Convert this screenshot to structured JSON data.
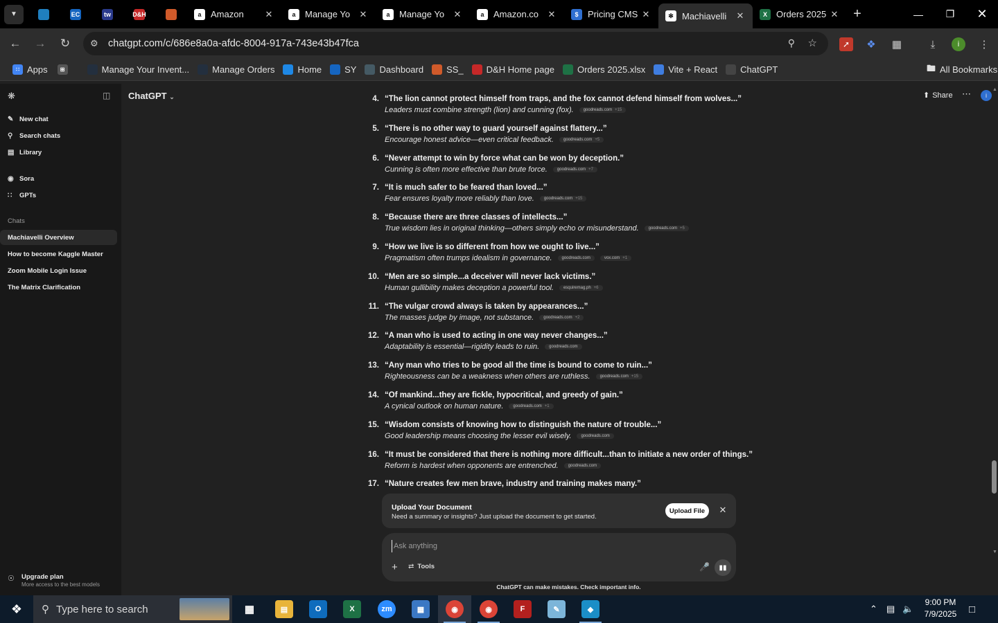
{
  "browser": {
    "tabs": [
      {
        "title": "Amazon",
        "favicon": "amazon-icon"
      },
      {
        "title": "Manage Yo",
        "favicon": "amazon-icon"
      },
      {
        "title": "Manage Yo",
        "favicon": "amazon-icon"
      },
      {
        "title": "Amazon.co",
        "favicon": "amazon-icon"
      },
      {
        "title": "Pricing CMS",
        "favicon": "dollar-icon"
      },
      {
        "title": "Machiavelli",
        "favicon": "openai-icon"
      },
      {
        "title": "Orders 2025",
        "favicon": "excel-icon"
      }
    ],
    "pinned_tabs": [
      {
        "label": "",
        "color": "#1f7fbf"
      },
      {
        "label": "EC",
        "color": "#1565c0"
      },
      {
        "label": "tw",
        "color": "#2a3a8c"
      },
      {
        "label": "D&H",
        "color": "#c62828"
      },
      {
        "label": "",
        "color": "#d05a2a"
      }
    ],
    "url": "chatgpt.com/c/686e8a0a-afdc-8004-917a-743e43b47fca",
    "bookmarks": [
      {
        "label": "Apps",
        "color": "#4285f4"
      },
      {
        "label": "",
        "color": "#555555"
      },
      {
        "label": "Manage Your Invent...",
        "color": "#232f3e"
      },
      {
        "label": "Manage Orders",
        "color": "#232f3e"
      },
      {
        "label": "Home",
        "color": "#1e88e5"
      },
      {
        "label": "SY",
        "color": "#1565c0"
      },
      {
        "label": "Dashboard",
        "color": "#455a64"
      },
      {
        "label": "SS_",
        "color": "#d05a2a"
      },
      {
        "label": "D&H Home page",
        "color": "#c62828"
      },
      {
        "label": "Orders 2025.xlsx",
        "color": "#1e7145"
      },
      {
        "label": "Vite + React",
        "color": "#3f7de0"
      },
      {
        "label": "ChatGPT",
        "color": "#444444"
      }
    ],
    "all_bookmarks": "All Bookmarks",
    "profile_initial": "i"
  },
  "sidebar": {
    "nav": [
      {
        "label": "New chat",
        "icon": "edit-icon"
      },
      {
        "label": "Search chats",
        "icon": "search-icon"
      },
      {
        "label": "Library",
        "icon": "library-icon"
      },
      {
        "label": "Sora",
        "icon": "sora-icon"
      },
      {
        "label": "GPTs",
        "icon": "gpts-icon"
      }
    ],
    "chats_heading": "Chats",
    "chats": [
      "Machiavelli Overview",
      "How to become Kaggle Master",
      "Zoom Mobile Login Issue",
      "The Matrix Clarification"
    ],
    "upgrade_title": "Upgrade plan",
    "upgrade_sub": "More access to the best models"
  },
  "header": {
    "model": "ChatGPT",
    "share": "Share",
    "profile_initial": "i"
  },
  "quotes": [
    {
      "num": "4.",
      "text": "“The lion cannot protect himself from traps, and the fox cannot defend himself from wolves...”",
      "note": "Leaders must combine strength (lion) and cunning (fox).",
      "sources": [
        "goodreads.com"
      ],
      "extra": "+15"
    },
    {
      "num": "5.",
      "text": "“There is no other way to guard yourself against flattery...”",
      "note": "Encourage honest advice—even critical feedback.",
      "sources": [
        "goodreads.com"
      ],
      "extra": "+5"
    },
    {
      "num": "6.",
      "text": "“Never attempt to win by force what can be won by deception.”",
      "note": "Cunning is often more effective than brute force.",
      "sources": [
        "goodreads.com"
      ],
      "extra": "+7"
    },
    {
      "num": "7.",
      "text": "“It is much safer to be feared than loved...”",
      "note": "Fear ensures loyalty more reliably than love.",
      "sources": [
        "goodreads.com"
      ],
      "extra": "+15"
    },
    {
      "num": "8.",
      "text": "“Because there are three classes of intellects...”",
      "note": "True wisdom lies in original thinking—others simply echo or misunderstand.",
      "sources": [
        "goodreads.com"
      ],
      "extra": "+5"
    },
    {
      "num": "9.",
      "text": "“How we live is so different from how we ought to live...”",
      "note": "Pragmatism often trumps idealism in governance.",
      "sources": [
        "goodreads.com",
        "vox.com"
      ],
      "extra": "+1"
    },
    {
      "num": "10.",
      "text": "“Men are so simple...a deceiver will never lack victims.”",
      "note": "Human gullibility makes deception a powerful tool.",
      "sources": [
        "esquiremag.ph"
      ],
      "extra": "+6"
    },
    {
      "num": "11.",
      "text": "“The vulgar crowd always is taken by appearances...”",
      "note": "The masses judge by image, not substance.",
      "sources": [
        "goodreads.com"
      ],
      "extra": "+2"
    },
    {
      "num": "12.",
      "text": "“A man who is used to acting in one way never changes...”",
      "note": "Adaptability is essential—rigidity leads to ruin.",
      "sources": [
        "goodreads.com"
      ],
      "extra": ""
    },
    {
      "num": "13.",
      "text": "“Any man who tries to be good all the time is bound to come to ruin...”",
      "note": "Righteousness can be a weakness when others are ruthless.",
      "sources": [
        "goodreads.com"
      ],
      "extra": "+15"
    },
    {
      "num": "14.",
      "text": "“Of mankind...they are fickle, hypocritical, and greedy of gain.”",
      "note": "A cynical outlook on human nature.",
      "sources": [
        "goodreads.com"
      ],
      "extra": "+1"
    },
    {
      "num": "15.",
      "text": "“Wisdom consists of knowing how to distinguish the nature of trouble...”",
      "note": "Good leadership means choosing the lesser evil wisely.",
      "sources": [
        "goodreads.com"
      ],
      "extra": ""
    },
    {
      "num": "16.",
      "text": "“It must be considered that there is nothing more difficult...than to initiate a new order of things.”",
      "note": "Reform is hardest when opponents are entrenched.",
      "sources": [
        "goodreads.com"
      ],
      "extra": ""
    },
    {
      "num": "17.",
      "text": "“Nature creates few men brave, industry and training makes many.”",
      "note": "",
      "sources": [],
      "extra": ""
    }
  ],
  "upload_card": {
    "title": "Upload Your Document",
    "subtitle": "Need a summary or insights? Just upload the document to get started.",
    "button": "Upload File"
  },
  "composer": {
    "placeholder": "Ask anything",
    "tools": "Tools"
  },
  "disclaimer": "ChatGPT can make mistakes. Check important info.",
  "taskbar": {
    "search_placeholder": "Type here to search",
    "time": "9:00 PM",
    "date": "7/9/2025"
  }
}
